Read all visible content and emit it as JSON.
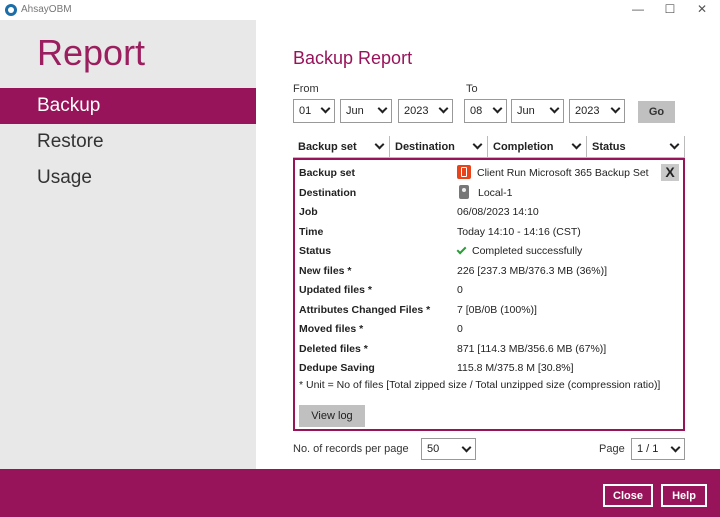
{
  "app": {
    "title": "AhsayOBM"
  },
  "window": {
    "minimize": "—",
    "maximize": "☐",
    "close": "✕"
  },
  "sidebar": {
    "title": "Report",
    "items": [
      {
        "label": "Backup",
        "active": true
      },
      {
        "label": "Restore",
        "active": false
      },
      {
        "label": "Usage",
        "active": false
      }
    ]
  },
  "main": {
    "title": "Backup Report",
    "from_label": "From",
    "to_label": "To",
    "from": {
      "day": "01",
      "month": "Jun",
      "year": "2023"
    },
    "to": {
      "day": "08",
      "month": "Jun",
      "year": "2023"
    },
    "go_label": "Go",
    "columns": [
      "Backup set",
      "Destination",
      "Completion",
      "Status"
    ],
    "detail": {
      "rows": [
        {
          "key": "Backup set",
          "value": "Client Run Microsoft 365 Backup Set",
          "icon": "office365-icon"
        },
        {
          "key": "Destination",
          "value": "Local-1",
          "icon": "local-drive-icon"
        },
        {
          "key": "Job",
          "value": "06/08/2023 14:10"
        },
        {
          "key": "Time",
          "value": "Today 14:10 - 14:16 (CST)"
        },
        {
          "key": "Status",
          "value": "Completed successfully",
          "icon": "check-icon"
        },
        {
          "key": "New files *",
          "value": "226 [237.3 MB/376.3 MB (36%)]"
        },
        {
          "key": "Updated files *",
          "value": "0"
        },
        {
          "key": "Attributes Changed Files *",
          "value": "7 [0B/0B (100%)]"
        },
        {
          "key": "Moved files *",
          "value": "0"
        },
        {
          "key": "Deleted files *",
          "value": "871 [114.3 MB/356.6 MB (67%)]"
        },
        {
          "key": "Dedupe Saving",
          "value": "115.8 M/375.8 M [30.8%]"
        }
      ],
      "note": "* Unit = No of files [Total zipped size / Total unzipped size (compression ratio)]",
      "view_log_label": "View log",
      "close_label": "X"
    },
    "records_label": "No. of records per page",
    "records_value": "50",
    "page_label": "Page",
    "page_value": "1 / 1"
  },
  "footer": {
    "close_label": "Close",
    "help_label": "Help"
  },
  "colors": {
    "accent": "#98145a",
    "sidebar_bg": "#e8e8e8",
    "button_gray": "#c0c0c0"
  }
}
